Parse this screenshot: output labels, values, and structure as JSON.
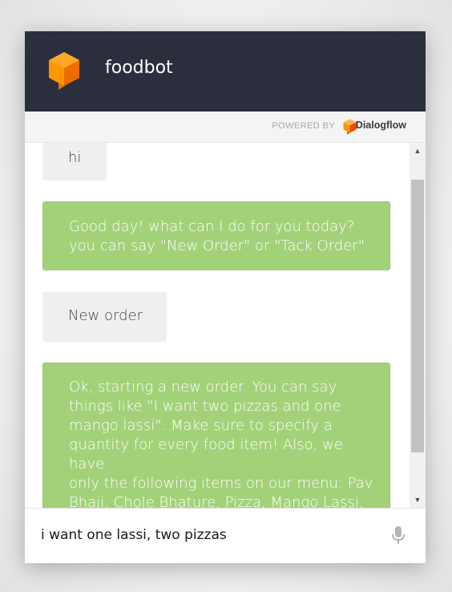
{
  "header": {
    "title": "foodbot",
    "logo_icon": "dialogflow-cube-icon",
    "background": "#2b2f3d"
  },
  "powered_by": {
    "label": "POWERED BY",
    "brand": "Dialogflow",
    "logo_icon": "dialogflow-logo-icon"
  },
  "messages": [
    {
      "role": "user",
      "text": "hi"
    },
    {
      "role": "bot",
      "text": "Good day! what can I do for you today?\nyou can say \"New Order\" or \"Tack Order\""
    },
    {
      "role": "user",
      "text": "New order"
    },
    {
      "role": "bot",
      "text": "Ok, starting a new order. You can say\nthings like \"I want two pizzas and one\nmango lassi\". Make sure to specify a\nquantity for every food item! Also, we have\nonly the following items on our menu: Pav\nBhaji, Chole Bhature, Pizza, Mango Lassi,\nMasala Dosa, Biryani, Vada Pav, Rava"
    }
  ],
  "input": {
    "value": "i want one lassi, two pizzas",
    "mic_icon": "microphone-icon"
  },
  "colors": {
    "bot_bubble": "#a3d17a",
    "user_bubble": "#efefef",
    "accent": "#ef8a00"
  }
}
